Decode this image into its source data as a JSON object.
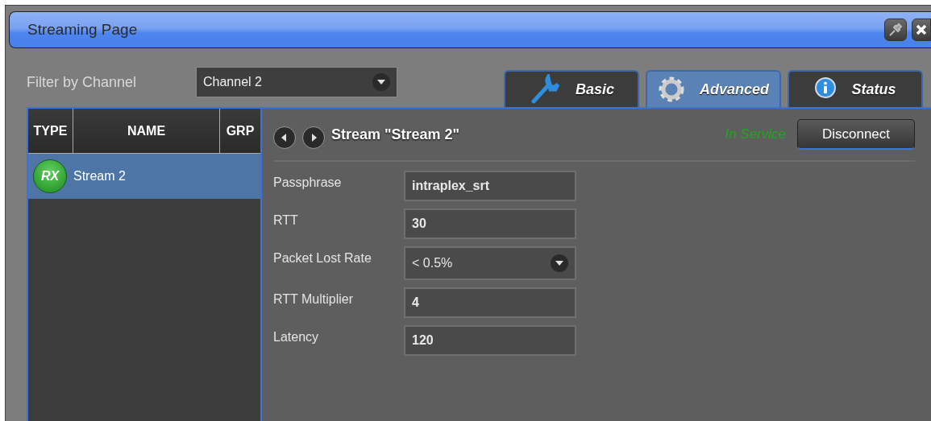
{
  "window": {
    "title": "Streaming Page"
  },
  "filter": {
    "label": "Filter by Channel",
    "value": "Channel 2"
  },
  "tabs": [
    {
      "label": "Basic",
      "selected": false
    },
    {
      "label": "Advanced",
      "selected": true
    },
    {
      "label": "Status",
      "selected": false
    }
  ],
  "table": {
    "columns": [
      "TYPE",
      "NAME",
      "GRP"
    ],
    "rows": [
      {
        "type": "RX",
        "name": "Stream 2",
        "selected": true
      }
    ]
  },
  "detail": {
    "title": "Stream \"Stream 2\"",
    "status": "In Service",
    "button": "Disconnect",
    "fields": [
      {
        "kind": "text",
        "label": "Passphrase",
        "value": "intraplex_srt"
      },
      {
        "kind": "text",
        "label": "RTT",
        "value": "30"
      },
      {
        "kind": "select",
        "label": "Packet Lost Rate",
        "value": "< 0.5%"
      },
      {
        "kind": "text",
        "label": "RTT Multiplier",
        "value": "4"
      },
      {
        "kind": "text",
        "label": "Latency",
        "value": "120"
      }
    ]
  }
}
